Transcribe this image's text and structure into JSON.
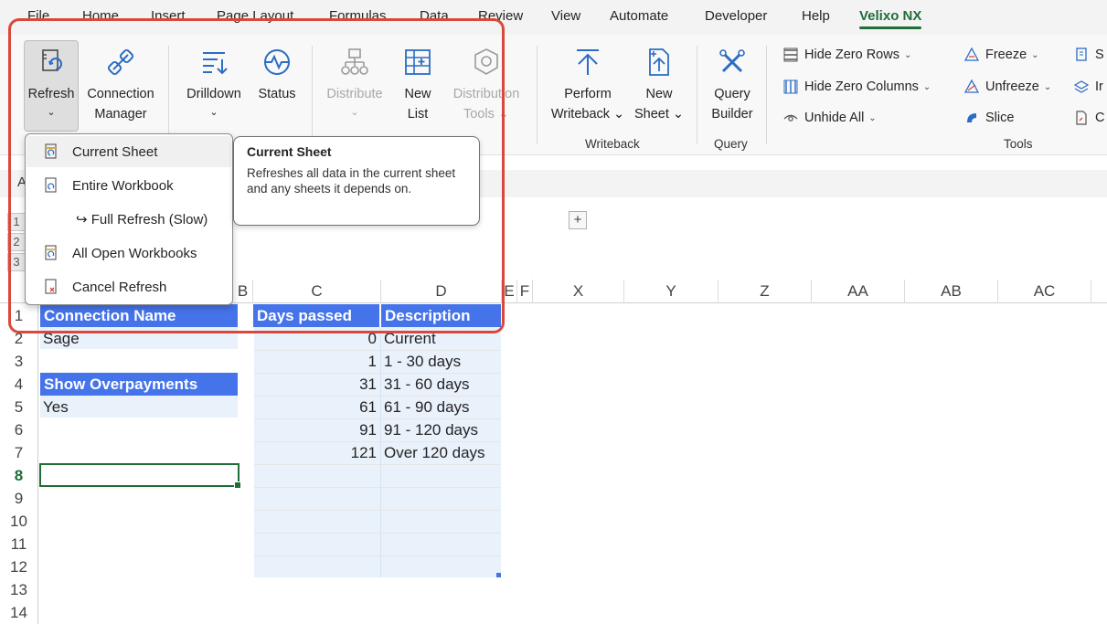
{
  "menubar": {
    "tabs": [
      "File",
      "Home",
      "Insert",
      "Page Layout",
      "Formulas",
      "Data",
      "Review",
      "View",
      "Automate",
      "Developer",
      "Help",
      "Velixo NX"
    ],
    "active_tab": "Velixo NX"
  },
  "ribbon": {
    "refresh": {
      "label": "Refresh",
      "chevron": "⌄"
    },
    "connection_manager": {
      "line1": "Connection",
      "line2": "Manager"
    },
    "drilldown": {
      "label": "Drilldown",
      "chevron": "⌄"
    },
    "status": {
      "label": "Status"
    },
    "distribute": {
      "label": "Distribute",
      "chevron": "⌄"
    },
    "new_list": {
      "line1": "New",
      "line2": "List"
    },
    "distribution_tools": {
      "line1": "Distribution",
      "line2": "Tools ⌄"
    },
    "perform_writeback": {
      "line1": "Perform",
      "line2": "Writeback ⌄"
    },
    "new_sheet": {
      "line1": "New",
      "line2": "Sheet ⌄"
    },
    "query_builder": {
      "line1": "Query",
      "line2": "Builder"
    },
    "hide_zero_rows": "Hide Zero Rows",
    "hide_zero_columns": "Hide Zero Columns",
    "unhide_all": "Unhide All",
    "freeze": "Freeze",
    "unfreeze": "Unfreeze",
    "slice": "Slice",
    "partial_s": "S",
    "partial_i": "Ir",
    "partial_c": "C",
    "groups": {
      "writeback": "Writeback",
      "query": "Query",
      "tools": "Tools"
    },
    "chevron": "⌄"
  },
  "refresh_menu": {
    "items": [
      {
        "label": "Current Sheet",
        "icon": "refresh-sheet-icon"
      },
      {
        "label": "Entire Workbook",
        "icon": "refresh-workbook-icon"
      },
      {
        "label": "↪ Full Refresh (Slow)",
        "icon": ""
      },
      {
        "label": "All Open Workbooks",
        "icon": "refresh-all-icon"
      },
      {
        "label": "Cancel Refresh",
        "icon": "cancel-refresh-icon"
      }
    ]
  },
  "tooltip": {
    "title": "Current Sheet",
    "body": "Refreshes all data in the current sheet and any sheets it depends on."
  },
  "sheet": {
    "name_box_letter": "A",
    "outline_levels": [
      "1",
      "2",
      "3"
    ],
    "expand_symbol": "+",
    "columns": [
      "B",
      "C",
      "D",
      "E",
      "F",
      "X",
      "Y",
      "Z",
      "AA",
      "AB",
      "AC"
    ],
    "rows": [
      "1",
      "2",
      "3",
      "4",
      "5",
      "6",
      "7",
      "8",
      "9",
      "10",
      "11",
      "12",
      "13",
      "14"
    ],
    "selected_row": "8",
    "cells": {
      "a1": "Connection Name",
      "a2": "Sage",
      "a4": "Show Overpayments",
      "a5": "Yes",
      "c1": "Days passed",
      "d1": "Description"
    },
    "aging": [
      {
        "days": "0",
        "desc": "Current"
      },
      {
        "days": "1",
        "desc": "1 - 30 days"
      },
      {
        "days": "31",
        "desc": "31 - 60 days"
      },
      {
        "days": "61",
        "desc": "61 - 90 days"
      },
      {
        "days": "91",
        "desc": "91 - 120 days"
      },
      {
        "days": "121",
        "desc": "Over 120 days"
      }
    ]
  },
  "colors": {
    "accent": "#1e6e36",
    "header_fill": "#4573ea",
    "highlight": "#d9483b"
  }
}
